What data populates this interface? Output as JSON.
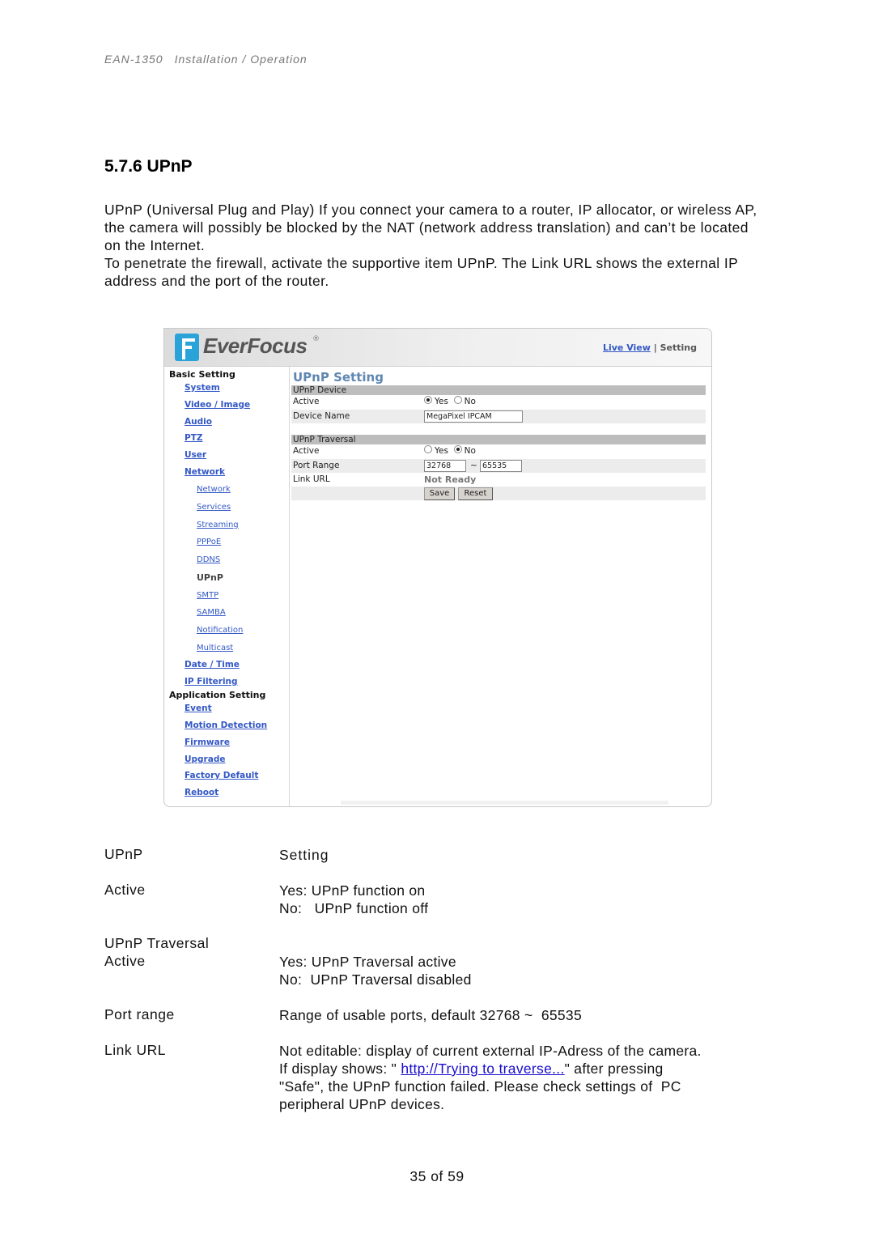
{
  "page_header": {
    "doc_id": "EAN-1350",
    "doc_title": "Installation / Operation"
  },
  "section_title": "5.7.6 UPnP",
  "intro": [
    "UPnP (Universal Plug and Play) If you connect your camera to a router, IP allocator, or wireless AP, the camera will possibly be blocked by the NAT (network address translation) and can’t be located on the Internet.",
    "To penetrate the firewall, activate the supportive item UPnP. The Link URL shows the external IP address and the port of the router."
  ],
  "screenshot": {
    "brand": "EverFocus",
    "brand_mark": "®",
    "top_links": {
      "live_view": "Live View",
      "separator": "|",
      "setting": "Setting"
    },
    "sidebar": {
      "basic_setting": "Basic Setting",
      "basic_items": [
        "System",
        "Video / Image",
        "Audio",
        "PTZ",
        "User",
        "Network"
      ],
      "network_sub": [
        "Network",
        "Services",
        "Streaming",
        "PPPoE",
        "DDNS",
        "UPnP",
        "SMTP",
        "SAMBA",
        "Notification",
        "Multicast"
      ],
      "current_sub": "UPnP",
      "basic_items_after": [
        "Date / Time",
        "IP Filtering"
      ],
      "application_setting": "Application Setting",
      "application_items": [
        "Event",
        "Motion Detection",
        "Firmware",
        "Upgrade",
        "Factory Default",
        "Reboot"
      ]
    },
    "form": {
      "title": "UPnP Setting",
      "device_section": "UPnP Device",
      "device_active_label": "Active",
      "device_active_value": "Yes",
      "yes_label": "Yes",
      "no_label": "No",
      "device_name_label": "Device Name",
      "device_name_value": "MegaPixel IPCAM",
      "traversal_section": "UPnP Traversal",
      "traversal_active_label": "Active",
      "traversal_active_value": "No",
      "port_range_label": "Port Range",
      "port_from": "32768",
      "port_sep": "~",
      "port_to": "65535",
      "link_url_label": "Link URL",
      "link_url_value": "Not Ready",
      "save_label": "Save",
      "reset_label": "Reset"
    }
  },
  "definitions": {
    "head_term": "UPnP",
    "head_value": "Setting",
    "active_term": "Active",
    "active_yes": "Yes: UPnP function on",
    "active_no": "No:   UPnP function off",
    "traversal_term": "UPnP Traversal",
    "traversal_active_term": "Active",
    "traversal_yes": "Yes: UPnP Traversal active",
    "traversal_no": "No:  UPnP Traversal disabled",
    "port_term": "Port range",
    "port_value": "Range of usable ports, default 32768 ~  65535",
    "link_term": "Link URL",
    "link_line1": "Not editable: display of current external IP-Adress of the camera.",
    "link_line2_pre": "If display shows: \" ",
    "link_line2_link": "http://Trying to traverse...",
    "link_line2_post": "\" after pressing",
    "link_line3": "\"Safe\", the UPnP function failed. Please check settings of  PC",
    "link_line4": "peripheral UPnP devices."
  },
  "footer": {
    "page": "35 of 59"
  }
}
